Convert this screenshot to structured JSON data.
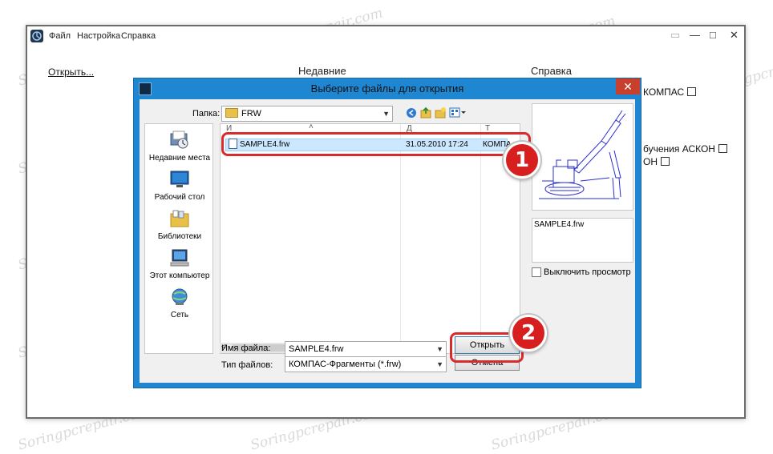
{
  "app": {
    "menu": [
      "Файл",
      "Настройка",
      "Справка"
    ],
    "controls": {
      "restore": "▭",
      "minimize": "—",
      "maximize": "□",
      "close": "✕"
    }
  },
  "home": {
    "open_link": "Открыть...",
    "recent_title": "Недавние",
    "help_title": "Справка",
    "help_links": [
      "КОМПАС",
      "бучения АСКОН",
      "ОН"
    ]
  },
  "dialog": {
    "title": "Выберите файлы для открытия",
    "close": "✕",
    "folder_label": "Папка:",
    "folder_value": "FRW",
    "places": [
      {
        "label": "Недавние места",
        "icon": "recent-places-icon"
      },
      {
        "label": "Рабочий стол",
        "icon": "desktop-icon"
      },
      {
        "label": "Библиотеки",
        "icon": "libraries-icon"
      },
      {
        "label": "Этот компьютер",
        "icon": "computer-icon"
      },
      {
        "label": "Сеть",
        "icon": "network-icon"
      }
    ],
    "columns": [
      "И",
      "Д",
      "Т"
    ],
    "files": [
      {
        "name": "SAMPLE4.frw",
        "date": "31.05.2010 17:24",
        "type": "КОМПА"
      }
    ],
    "preview_name": "SAMPLE4.frw",
    "disable_preview": "Выключить просмотр",
    "filename_label": "Имя файла:",
    "filename_value": "SAMPLE4.frw",
    "filetype_label": "Тип файлов:",
    "filetype_value": "КОМПАС-Фрагменты (*.frw)",
    "open_button": "Открыть",
    "cancel_button": "Отмена"
  },
  "callouts": [
    "1",
    "2"
  ],
  "watermark": "Soringpcrepair.com",
  "colors": {
    "dialog_frame": "#1f86d1",
    "selection": "#cce8ff",
    "callout": "#d92b2b"
  }
}
